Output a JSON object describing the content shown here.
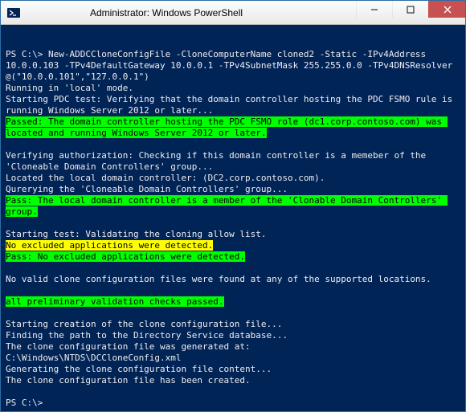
{
  "window": {
    "title": "Administrator: Windows PowerShell"
  },
  "terminal": {
    "lines": [
      {
        "text": "PS C:\\> New-ADDCCloneConfigFile -CloneComputerName cloned2 -Static -IPv4Address 10.0.0.103 -TPv4DefaultGateway 10.0.0.1 -TPv4SubnetMask 255.255.0.0 -TPv4DNSResolver @(\"10.0.0.101\",\"127.0.0.1\")",
        "style": "plain"
      },
      {
        "text": "Running in 'local' mode.",
        "style": "plain"
      },
      {
        "text": "Starting PDC test: Verifying that the domain controller hosting the PDC FSMO rule is running Windows Server 2012 or later...",
        "style": "plain"
      },
      {
        "text": "Passed: The domain controller hosting the PDC FSMO role (dc1.corp.contoso.com) was located and running Windows Server 2012 or later.",
        "style": "green"
      },
      {
        "text": "",
        "style": "plain"
      },
      {
        "text": "Verifying authorization: Checking if this domain controller is a memeber of the 'Cloneable Domain Controllers' group...",
        "style": "plain"
      },
      {
        "text": "Located the local domain controller: (DC2.corp.contoso.com).",
        "style": "plain"
      },
      {
        "text": "Qurerying the 'Cloneable Domain Controllers' group...",
        "style": "plain"
      },
      {
        "text": "Pass: The local domain controller is a member of the 'Clonable Domain Controllers' group.",
        "style": "green"
      },
      {
        "text": "",
        "style": "plain"
      },
      {
        "text": "Starting test: Validating the cloning allow list.",
        "style": "plain"
      },
      {
        "text": "No excluded applications were detected.",
        "style": "yellow"
      },
      {
        "text": "Pass: No excluded applications were detected.",
        "style": "green"
      },
      {
        "text": "",
        "style": "plain"
      },
      {
        "text": "No valid clone configuration files were found at any of the supported locations.",
        "style": "plain"
      },
      {
        "text": "",
        "style": "plain"
      },
      {
        "text": "all preliminary validation checks passed.",
        "style": "green"
      },
      {
        "text": "",
        "style": "plain"
      },
      {
        "text": "Starting creation of the clone configuration file...",
        "style": "plain"
      },
      {
        "text": "Finding the path to the Directory Service database...",
        "style": "plain"
      },
      {
        "text": "The clone configuration file was generated at:",
        "style": "plain"
      },
      {
        "text": "C:\\Windows\\NTDS\\DCCloneConfig.xml",
        "style": "plain"
      },
      {
        "text": "Generating the clone configuration file content...",
        "style": "plain"
      },
      {
        "text": "The clone configuration file has been created.",
        "style": "plain"
      },
      {
        "text": "",
        "style": "plain"
      },
      {
        "text": "PS C:\\>",
        "style": "plain"
      }
    ]
  }
}
